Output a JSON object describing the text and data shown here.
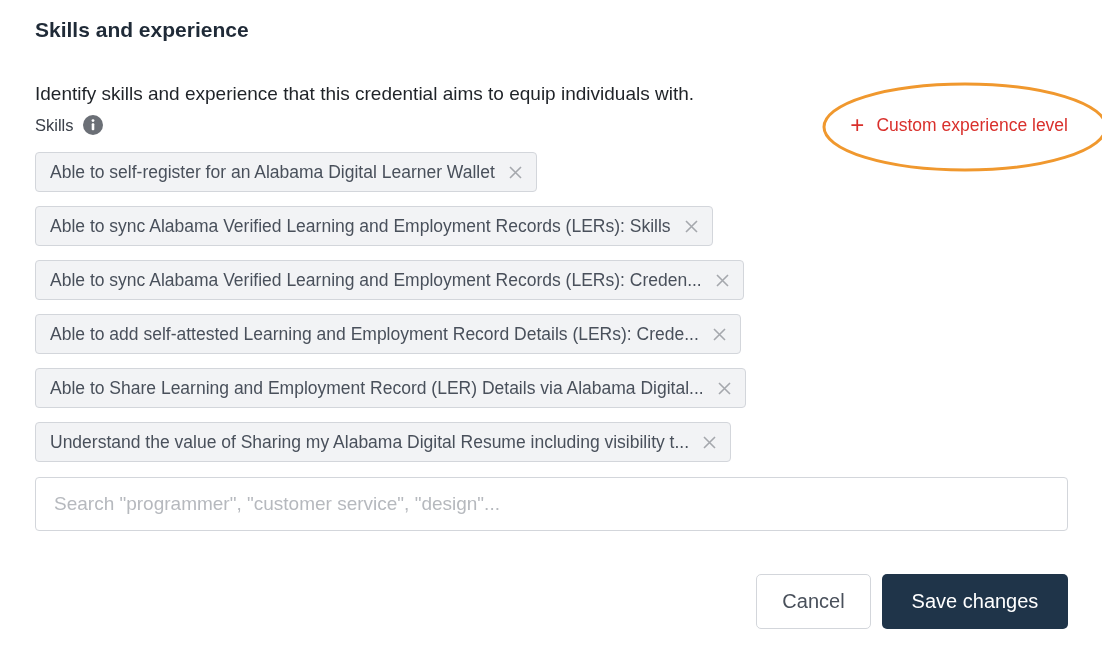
{
  "section": {
    "title": "Skills and experience",
    "description": "Identify skills and experience that this credential aims to equip individuals with."
  },
  "skills_label": "Skills",
  "custom_button": {
    "label": "Custom experience level",
    "icon": "+",
    "circled": true
  },
  "skills": [
    {
      "label": "Able to self-register for an Alabama Digital Learner Wallet"
    },
    {
      "label": "Able to sync Alabama Verified Learning and Employment Records (LERs): Skills"
    },
    {
      "label": "Able to sync Alabama Verified Learning and Employment Records (LERs): Creden..."
    },
    {
      "label": "Able to add self-attested Learning and Employment Record Details (LERs): Crede..."
    },
    {
      "label": "Able to Share Learning and Employment Record (LER) Details via Alabama Digital..."
    },
    {
      "label": "Understand the value of Sharing my Alabama Digital Resume including visibility t..."
    }
  ],
  "search": {
    "placeholder": "Search \"programmer\", \"customer service\", \"design\"..."
  },
  "buttons": [
    {
      "label": "Cancel",
      "kind": "secondary"
    },
    {
      "label": "Save changes",
      "kind": "primary"
    }
  ]
}
